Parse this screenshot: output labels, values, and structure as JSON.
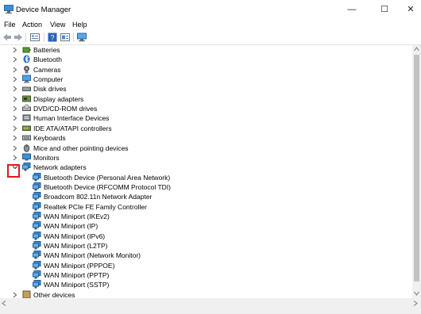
{
  "window": {
    "title": "Device Manager"
  },
  "menu": [
    "File",
    "Action",
    "View",
    "Help"
  ],
  "tree": {
    "categories_before": [
      {
        "label": "Batteries",
        "icon": "battery-icon"
      },
      {
        "label": "Bluetooth",
        "icon": "bluetooth-icon"
      },
      {
        "label": "Cameras",
        "icon": "camera-icon"
      },
      {
        "label": "Computer",
        "icon": "computer-icon"
      },
      {
        "label": "Disk drives",
        "icon": "disk-drive-icon"
      },
      {
        "label": "Display adapters",
        "icon": "display-adapter-icon"
      },
      {
        "label": "DVD/CD-ROM drives",
        "icon": "dvd-drive-icon"
      },
      {
        "label": "Human Interface Devices",
        "icon": "hid-icon"
      },
      {
        "label": "IDE ATA/ATAPI controllers",
        "icon": "ide-controller-icon"
      },
      {
        "label": "Keyboards",
        "icon": "keyboard-icon"
      },
      {
        "label": "Mice and other pointing devices",
        "icon": "mouse-icon"
      },
      {
        "label": "Monitors",
        "icon": "monitor-icon"
      }
    ],
    "expanded_category": {
      "label": "Network adapters",
      "icon": "network-adapter-icon"
    },
    "network_devices": [
      "Bluetooth Device (Personal Area Network)",
      "Bluetooth Device (RFCOMM Protocol TDI)",
      "Broadcom 802.11n Network Adapter",
      "Realtek PCIe FE Family Controller",
      "WAN Miniport (IKEv2)",
      "WAN Miniport (IP)",
      "WAN Miniport (IPv6)",
      "WAN Miniport (L2TP)",
      "WAN Miniport (Network Monitor)",
      "WAN Miniport (PPPOE)",
      "WAN Miniport (PPTP)",
      "WAN Miniport (SSTP)"
    ],
    "partial_category": {
      "label": "Other devices",
      "icon": "other-devices-icon"
    }
  },
  "colors": {
    "highlight": "#e2171d",
    "network_icon": "#3c8fd6"
  }
}
